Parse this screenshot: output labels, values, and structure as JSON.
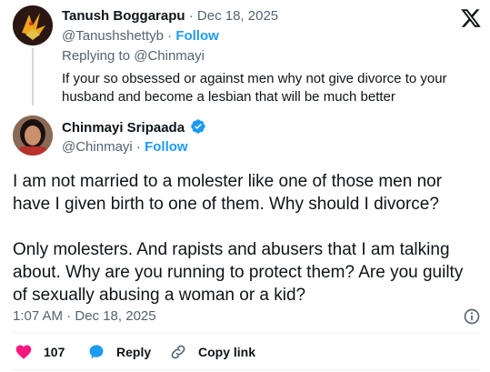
{
  "parent_tweet": {
    "author_name": "Tanush Boggarapu",
    "date": "Dec 18, 2025",
    "handle": "@Tanushshettyb",
    "follow_label": "Follow",
    "replying_to_prefix": "Replying to",
    "replying_to_handle": "@Chinmayi",
    "text": "If your so obsessed or against men why not give divorce to your husband and become a lesbian that will be much better"
  },
  "main_tweet": {
    "author_name": "Chinmayi Sripaada",
    "verified": true,
    "handle": "@Chinmayi",
    "follow_label": "Follow",
    "paragraphs": [
      "I am not married to a molester like one of those men nor have I given birth to one of them. Why should I divorce?",
      "Only molesters. And rapists and abusers that I am talking about. Why are you running to protect them? Are you guilty of sexually abusing a woman or a kid?"
    ],
    "timestamp": "1:07 AM · Dec 18, 2025"
  },
  "actions": {
    "like_count": "107",
    "reply_label": "Reply",
    "copy_link_label": "Copy link"
  },
  "colors": {
    "accent": "#1d9bf0",
    "like": "#f91880",
    "text": "#0f1419",
    "muted": "#536471"
  },
  "icons": [
    "x-logo-icon",
    "verified-badge-icon",
    "info-icon",
    "heart-icon",
    "reply-bubble-icon",
    "link-icon"
  ]
}
